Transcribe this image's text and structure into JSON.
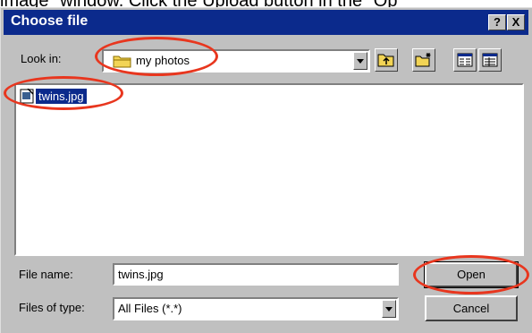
{
  "caption": "image\" window. Click the Upload button in the \"Op",
  "dialog": {
    "title": "Choose file",
    "help_label": "?",
    "close_label": "X",
    "look_in_label": "Look in:",
    "look_in_value": "my photos",
    "files": [
      {
        "name": "twins.jpg"
      }
    ],
    "file_name_label": "File name:",
    "file_name_value": "twins.jpg",
    "files_of_type_label": "Files of type:",
    "files_of_type_value": "All Files (*.*)",
    "open_label": "Open",
    "cancel_label": "Cancel"
  },
  "colors": {
    "titlebar": "#0b2a8c",
    "highlight_circle": "#e8361e",
    "dialog_bg": "#c0c0c0"
  },
  "icons": [
    "folder-icon",
    "up-folder-icon",
    "new-folder-icon",
    "list-view-icon",
    "details-view-icon",
    "file-icon",
    "dropdown-arrow-icon"
  ]
}
